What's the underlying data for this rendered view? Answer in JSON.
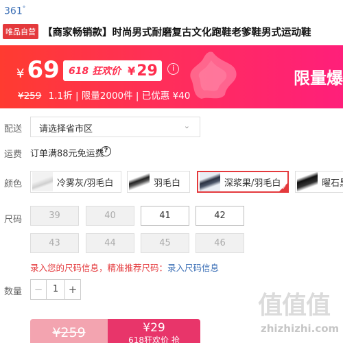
{
  "brand": {
    "name": "361",
    "mark": "°"
  },
  "title": {
    "badge": "唯品自营",
    "text": "【商家畅销款】时尚男式耐磨复古文化跑鞋老爹鞋男式运动鞋"
  },
  "price": {
    "currency": "¥",
    "current": "69",
    "festival_label": "618 狂欢价",
    "festival_currency": "¥",
    "festival_price": "29",
    "info_icon": "info-icon",
    "limited_text": "限量爆",
    "original": "¥259",
    "discount": "1.1折",
    "details": "| 限量2000件 | 已优惠 ¥40"
  },
  "delivery": {
    "label": "配送",
    "placeholder": "请选择省市区"
  },
  "shipping": {
    "label": "运费",
    "text": "订单满88元免运费"
  },
  "color": {
    "label": "颜色",
    "options": [
      {
        "label": "冷雾灰/羽毛白",
        "selected": false
      },
      {
        "label": "羽毛白",
        "selected": false
      },
      {
        "label": "深浆果/羽毛白",
        "selected": true
      },
      {
        "label": "曜石黑",
        "selected": false
      }
    ]
  },
  "size": {
    "label": "尺码",
    "options": [
      {
        "label": "39",
        "available": false
      },
      {
        "label": "40",
        "available": false
      },
      {
        "label": "41",
        "available": true
      },
      {
        "label": "42",
        "available": true
      },
      {
        "label": "43",
        "available": false
      },
      {
        "label": "44",
        "available": false
      },
      {
        "label": "45",
        "available": false
      },
      {
        "label": "46",
        "available": false
      }
    ],
    "hint": "录入您的尺码信息，精准推荐尺码：",
    "hint_link": "录入尺码信息"
  },
  "quantity": {
    "label": "数量",
    "value": "1",
    "minus": "−",
    "plus": "+"
  },
  "buy": {
    "original_price": "¥259",
    "festival_price": "¥29",
    "festival_action": "618狂欢价 抢"
  },
  "watermark": {
    "logo": "值值值",
    "url": "zhizhizhi.com"
  },
  "colors": {
    "accent": "#e4393c",
    "banner_start": "#ff3b30",
    "banner_end": "#ff1f7a",
    "link": "#3b6fb6"
  }
}
